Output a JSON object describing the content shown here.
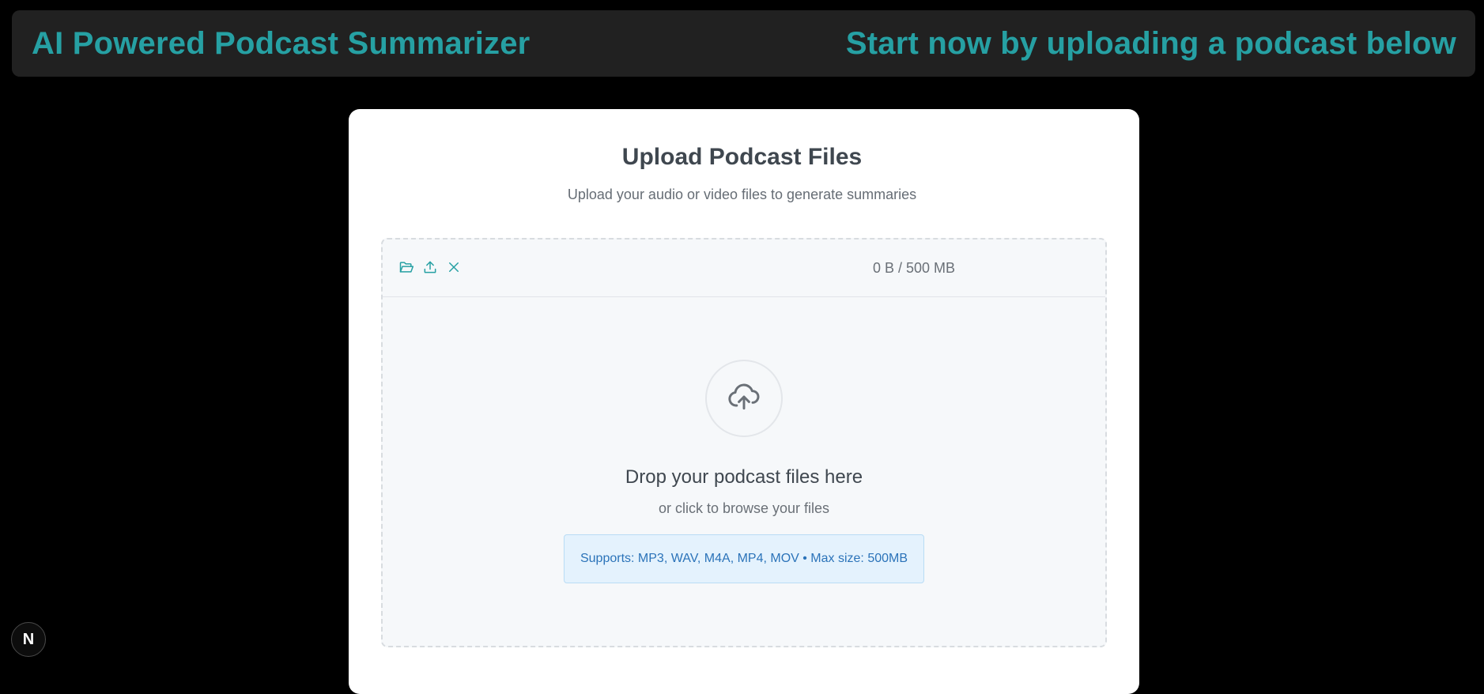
{
  "header": {
    "title": "AI Powered Podcast Summarizer",
    "tagline": "Start now by uploading a podcast below"
  },
  "upload_card": {
    "title": "Upload Podcast Files",
    "subtitle": "Upload your audio or video files to generate summaries"
  },
  "uploader": {
    "toolbar": {
      "choose_icon": "folder-open-icon",
      "upload_icon": "upload-icon",
      "cancel_icon": "close-icon",
      "size_text": "0 B / 500 MB"
    },
    "drop_icon": "cloud-upload-icon",
    "drop_title": "Drop your podcast files here",
    "drop_subtitle": "or click to browse your files",
    "supports_text": "Supports: MP3, WAV, M4A, MP4, MOV • Max size: 500MB"
  },
  "dev_badge": {
    "label": "N"
  },
  "colors": {
    "accent": "#26a0a3",
    "background": "#000000",
    "header_bg": "#212121",
    "card_bg": "#ffffff",
    "info_bg": "#e4f2fd",
    "info_text": "#2b73b9"
  }
}
